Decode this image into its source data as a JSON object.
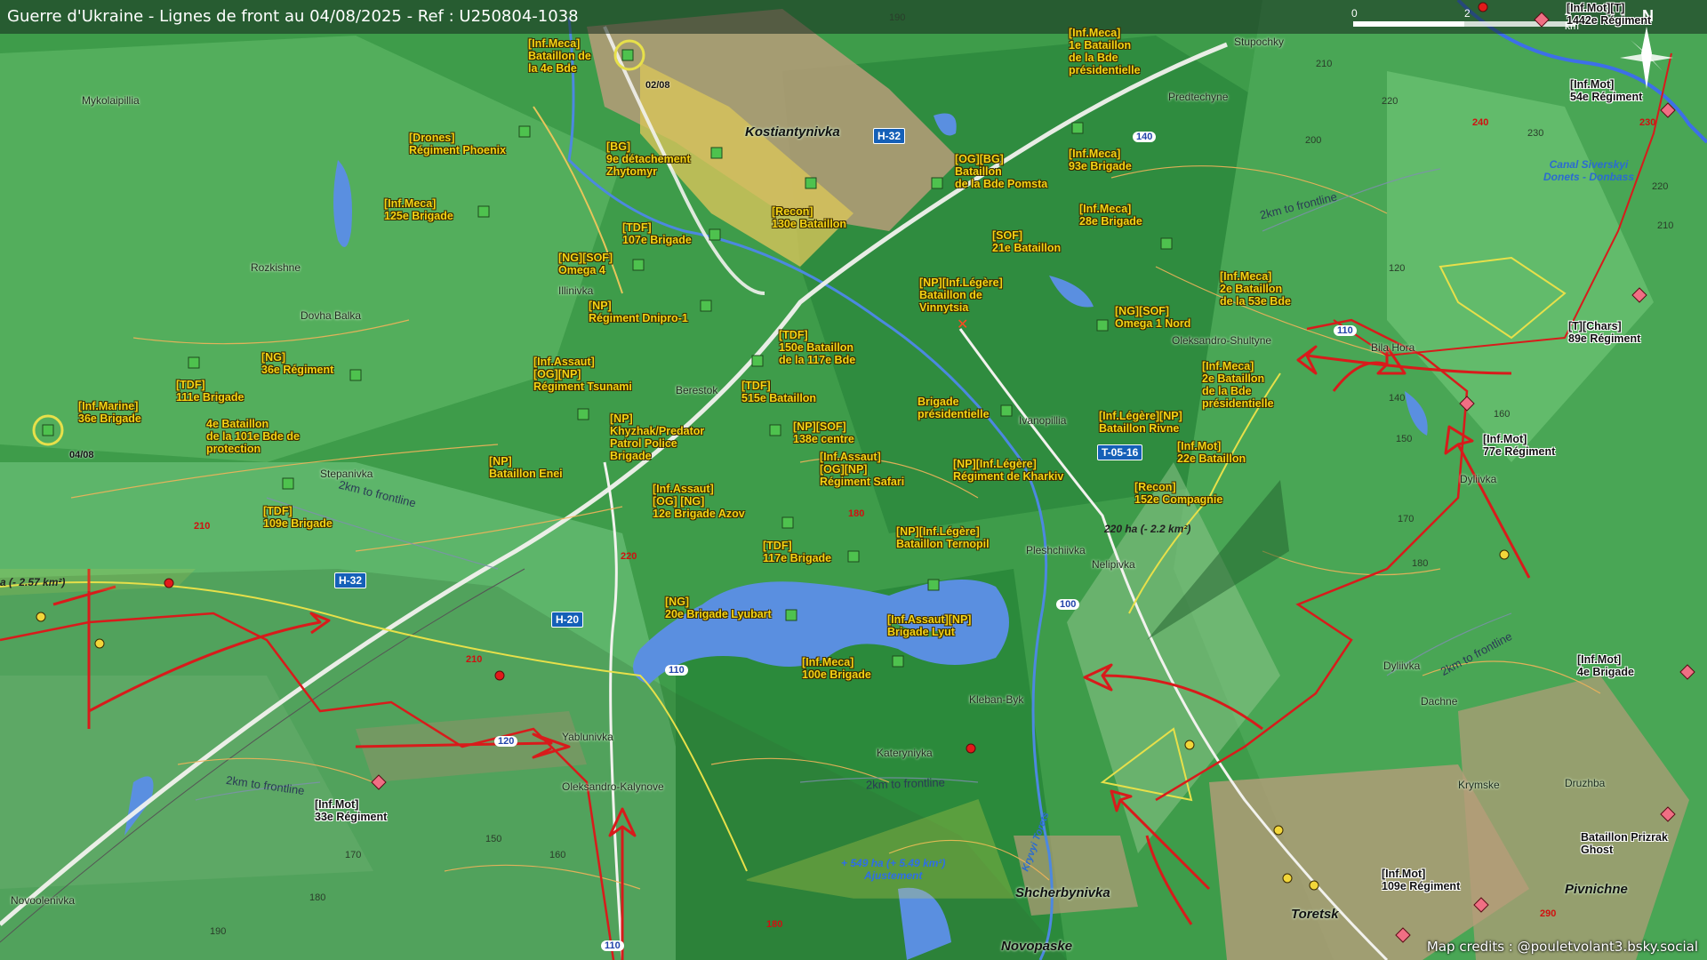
{
  "title": "Guerre d'Ukraine - Lignes de front au 04/08/2025 - Ref : U250804-1038",
  "credits": "Map credits : @pouletvolant3.bsky.social",
  "scale": {
    "ticks": [
      "0",
      "2",
      "4 km"
    ]
  },
  "north_label": "N",
  "colors": {
    "ua_front": "#d81b1b",
    "ru_zone": "#e7e04a",
    "water": "#5a8fe0",
    "urban": "#b79c79"
  },
  "ua_units": [
    {
      "text": "[Inf.Meca]\nBataillon de\nla 4e Bde"
    },
    {
      "text": "[Drones]\nRégiment Phoenix"
    },
    {
      "text": "[BG]\n9e détachement\nZhytomyr"
    },
    {
      "text": "[Inf.Meca]\n125e Brigade"
    },
    {
      "text": "[TDF]\n107e Brigade"
    },
    {
      "text": "[Recon]\n130e Bataillon"
    },
    {
      "text": "[OG][BG]\nBataillon\nde la Bde Pomsta"
    },
    {
      "text": "[Inf.Meca]\n1e Bataillon\nde la Bde\nprésidentielle"
    },
    {
      "text": "[Inf.Meca]\n93e Brigade"
    },
    {
      "text": "[Inf.Meca]\n28e Brigade"
    },
    {
      "text": "[SOF]\n21e Bataillon"
    },
    {
      "text": "[NG][SOF]\nOmega 4"
    },
    {
      "text": "[NP]\nRégiment Dnipro-1"
    },
    {
      "text": "[NP][Inf.Légère]\nBataillon de\nVinnytsia"
    },
    {
      "text": "[Inf.Meca]\n2e Bataillon\nde la 53e Bde"
    },
    {
      "text": "[NG][SOF]\nOmega 1 Nord"
    },
    {
      "text": "[TDF]\n150e Bataillon\nde la 117e Bde"
    },
    {
      "text": "[NG]\n36e Régiment"
    },
    {
      "text": "[TDF]\n111e Brigade"
    },
    {
      "text": "[Inf.Assaut]\n[OG][NP]\nRégiment Tsunami"
    },
    {
      "text": "[TDF]\n515e Bataillon"
    },
    {
      "text": "Brigade\nprésidentielle"
    },
    {
      "text": "[Inf.Meca]\n2e Bataillon\nde la Bde\nprésidentielle"
    },
    {
      "text": "[Inf.Marine]\n36e Brigade"
    },
    {
      "text": "4e Bataillon\nde la 101e Bde de\nprotection"
    },
    {
      "text": "[NP]\nKhyzhak/Predator\nPatrol Police\nBrigade"
    },
    {
      "text": "[NP][SOF]\n138e centre"
    },
    {
      "text": "[Inf.Légère][NP]\nBataillon Rivne"
    },
    {
      "text": "[Inf.Mot]\n22e Bataillon"
    },
    {
      "text": "[NP]\nBataillon Enei"
    },
    {
      "text": "[Inf.Assaut]\n[OG][NP]\nRégiment Safari"
    },
    {
      "text": "[NP][Inf.Légère]\nRégiment de Kharkiv"
    },
    {
      "text": "[Recon]\n152e Compagnie"
    },
    {
      "text": "[TDF]\n109e Brigade"
    },
    {
      "text": "[Inf.Assaut]\n[OG] [NG]\n12e Brigade Azov"
    },
    {
      "text": "[NP][Inf.Légère]\nBataillon Ternopil"
    },
    {
      "text": "[TDF]\n117e Brigade"
    },
    {
      "text": "[NG]\n20e Brigade Lyubart"
    },
    {
      "text": "[Inf.Assaut][NP]\nBrigade Lyut"
    },
    {
      "text": "[Inf.Meca]\n100e Brigade"
    }
  ],
  "ru_units": [
    {
      "text": "[Inf.Mot][T]\n1442e Régiment"
    },
    {
      "text": "[Inf.Mot]\n54e Régiment"
    },
    {
      "text": "[T][Chars]\n89e Régiment"
    },
    {
      "text": "[Inf.Mot]\n77e Régiment"
    },
    {
      "text": "[Inf.Mot]\n4e Brigade"
    },
    {
      "text": "[Inf.Mot]\n33e Régiment"
    },
    {
      "text": "[Inf.Mot]\n109e Régiment"
    },
    {
      "text": "Bataillon Prizrak\nGhost"
    }
  ],
  "places": [
    {
      "text": "Kostiantynivka",
      "cls": "town"
    },
    {
      "text": "Mykolaipillia"
    },
    {
      "text": "Rozkishne"
    },
    {
      "text": "Dovha Balka"
    },
    {
      "text": "Illinivka"
    },
    {
      "text": "Stupochky"
    },
    {
      "text": "Predtechyne"
    },
    {
      "text": "Oleksandro-Shultyne"
    },
    {
      "text": "Bila Hora"
    },
    {
      "text": "Berestok"
    },
    {
      "text": "Ivanopillia"
    },
    {
      "text": "Stepanivka"
    },
    {
      "text": "Pleshchiivka"
    },
    {
      "text": "Nelipivka"
    },
    {
      "text": "Dyliivka"
    },
    {
      "text": "Dachne"
    },
    {
      "text": "Krymske"
    },
    {
      "text": "Druzhba"
    },
    {
      "text": "Yablunivka"
    },
    {
      "text": "Oleksandro-Kalynove"
    },
    {
      "text": "Kleban-Byk"
    },
    {
      "text": "Kateryniyka"
    },
    {
      "text": "Novoolenivka"
    },
    {
      "text": "Shcherbynivka",
      "cls": "town"
    },
    {
      "text": "Toretsk",
      "cls": "town"
    },
    {
      "text": "Pivnichne",
      "cls": "town"
    },
    {
      "text": "Novopaske",
      "cls": "town"
    },
    {
      "text": "Dyliivka"
    }
  ],
  "altitudes": [
    {
      "text": "190"
    },
    {
      "text": "210"
    },
    {
      "text": "220"
    },
    {
      "text": "200"
    },
    {
      "text": "230"
    },
    {
      "text": "240",
      "cls": "red"
    },
    {
      "text": "230",
      "cls": "red"
    },
    {
      "text": "220"
    },
    {
      "text": "210"
    },
    {
      "text": "120"
    },
    {
      "text": "140"
    },
    {
      "text": "150"
    },
    {
      "text": "160"
    },
    {
      "text": "170"
    },
    {
      "text": "180"
    },
    {
      "text": "210",
      "cls": "red"
    },
    {
      "text": "220",
      "cls": "red"
    },
    {
      "text": "180",
      "cls": "red"
    },
    {
      "text": "210",
      "cls": "red"
    },
    {
      "text": "170"
    },
    {
      "text": "160"
    },
    {
      "text": "150"
    },
    {
      "text": "180"
    },
    {
      "text": "190"
    },
    {
      "text": "180",
      "cls": "red"
    },
    {
      "text": "290",
      "cls": "red"
    }
  ],
  "roads": [
    {
      "text": "H-32"
    },
    {
      "text": "H-32"
    },
    {
      "text": "H-20"
    },
    {
      "text": "T-05-16"
    }
  ],
  "routes": [
    {
      "text": "140"
    },
    {
      "text": "110"
    },
    {
      "text": "100"
    },
    {
      "text": "110"
    },
    {
      "text": "120"
    },
    {
      "text": "110"
    }
  ],
  "frontline_labels": [
    {
      "text": "2km to frontline"
    },
    {
      "text": "2km to frontline"
    },
    {
      "text": "2km to frontline"
    },
    {
      "text": "2km to frontline"
    },
    {
      "text": "2km to frontline"
    }
  ],
  "canal": "Canal Siverskyi\nDonets - Donbass",
  "river": "Kryvyi Torets",
  "areas": [
    {
      "text": "220 ha (- 2.2 km²)"
    },
    {
      "text": "a (- 2.57 km²)"
    },
    {
      "text": "+ 549 ha (+ 5.49 km²)\nAjustement",
      "cls": "blue"
    }
  ],
  "dates": [
    {
      "text": "02/08"
    },
    {
      "text": "04/08"
    }
  ]
}
